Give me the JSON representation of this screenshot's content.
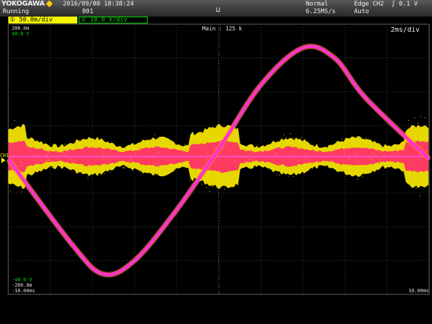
{
  "header": {
    "brand": "YOKOGAWA",
    "datetime": "2016/09/08  18:38:24",
    "status": "Running",
    "acq_count": "801",
    "trigger_position_mark": "⊔",
    "acq_mode": "Normal",
    "sample_rate": "6.25MS/s",
    "trigger_info": "Edge CH2  ʃ 0.1 V",
    "trigger_mode": "Auto"
  },
  "channels": {
    "ch1": {
      "label": "① 50.0m/div",
      "color": "#f5f500"
    },
    "ch2": {
      "label": "② 10.0 V/div",
      "color": "#00dd00"
    }
  },
  "scope": {
    "main_label": "Main : 125 k",
    "time_per_div": "2ms/div",
    "ch1_top": "200.0m",
    "ch2_top": "40.0 V",
    "ch2_bottom": "-40.0 V",
    "ch1_bottom": "-200.0m",
    "time_start": "-10.00ms",
    "time_end": "10.00ms",
    "ch1_marker": "CH1"
  },
  "chart_data": {
    "type": "line",
    "xlabel": "",
    "ylabel": "",
    "xlim": [
      -10,
      10
    ],
    "time_unit": "ms",
    "series": [
      {
        "color": "#ff33cc",
        "x": [
          -10,
          -7,
          -5.5,
          -4,
          -2,
          0,
          2,
          4,
          5.5,
          7,
          10
        ],
        "y": [
          0,
          -25,
          -34,
          -30,
          -15,
          3,
          22,
          33,
          30,
          18,
          0
        ],
        "ylim": [
          -40,
          40
        ]
      }
    ],
    "noise_band": {
      "color": "#ffee00",
      "core_color": "#ff3366"
    },
    "grid": true
  }
}
